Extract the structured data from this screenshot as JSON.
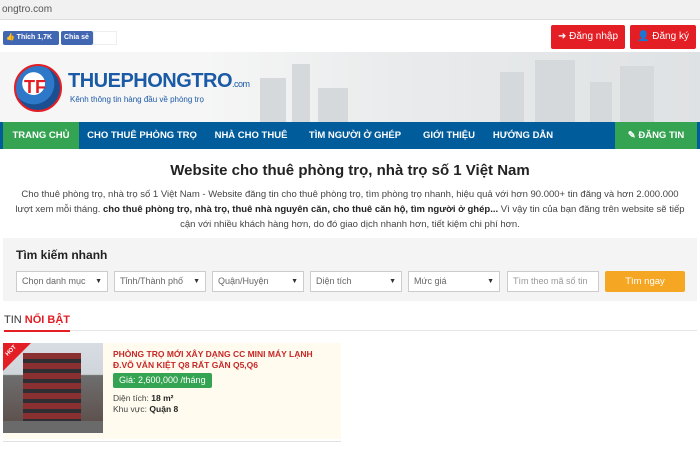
{
  "browser": {
    "url": "ongtro.com"
  },
  "social": {
    "like_label": "Thích 1,7K",
    "share_label": "Chia sẻ"
  },
  "auth": {
    "login_label": "Đăng nhập",
    "register_label": "Đăng ký"
  },
  "logo": {
    "mark": "TF",
    "name": "THUEPHONGTRO",
    "tld": ".com",
    "slogan": "Kênh thông tin hàng đầu về phòng trọ"
  },
  "nav": {
    "items": [
      {
        "label": "TRANG CHỦ"
      },
      {
        "label": "CHO THUÊ PHÒNG TRỌ"
      },
      {
        "label": "NHÀ CHO THUÊ"
      },
      {
        "label": "TÌM NGƯỜI Ở GHÉP"
      },
      {
        "label": "GIỚI THIỆU"
      },
      {
        "label": "HƯỚNG DẪN"
      }
    ],
    "post_label": "ĐĂNG TIN"
  },
  "intro": {
    "title": "Website cho thuê phòng trọ, nhà trọ số 1 Việt Nam",
    "text_a": "Cho thuê phòng trọ, nhà trọ số 1 Việt Nam - Website đăng tin cho thuê phòng trọ, tìm phòng trọ nhanh, hiệu quả với hơn 90.000+ tin đăng và hơn 2.000.000 lượt xem mỗi tháng.",
    "text_bold": "cho thuê phòng trọ, nhà trọ, thuê nhà nguyên căn, cho thuê căn hộ, tìm người ở ghép...",
    "text_b": "Vì vậy tin của bạn đăng trên website sẽ tiếp cận với nhiều khách hàng hơn, do đó giao dịch nhanh hơn, tiết kiệm chi phí hơn."
  },
  "search": {
    "title": "Tìm kiếm nhanh",
    "category": "Chọn danh mục",
    "city": "Tỉnh/Thành phố",
    "district": "Quận/Huyện",
    "area": "Diện tích",
    "price": "Mức giá",
    "code_placeholder": "Tìm theo mã số tin",
    "button": "Tìm ngay"
  },
  "featured": {
    "label_prefix": "TIN",
    "label_highlight": "NỔI BẬT",
    "listing": {
      "badge": "HOT",
      "title": "PHÒNG TRỌ MỚI XÂY DẠNG CC MINI MÁY LẠNH Đ.VÕ VĂN KIỆT Q8 RẤT GẦN Q5,Q6",
      "price": "Giá: 2,600,000 /tháng",
      "area_label": "Diện tích:",
      "area_value": "18 m²",
      "region_label": "Khu vực:",
      "region_value": "Quận 8"
    }
  }
}
